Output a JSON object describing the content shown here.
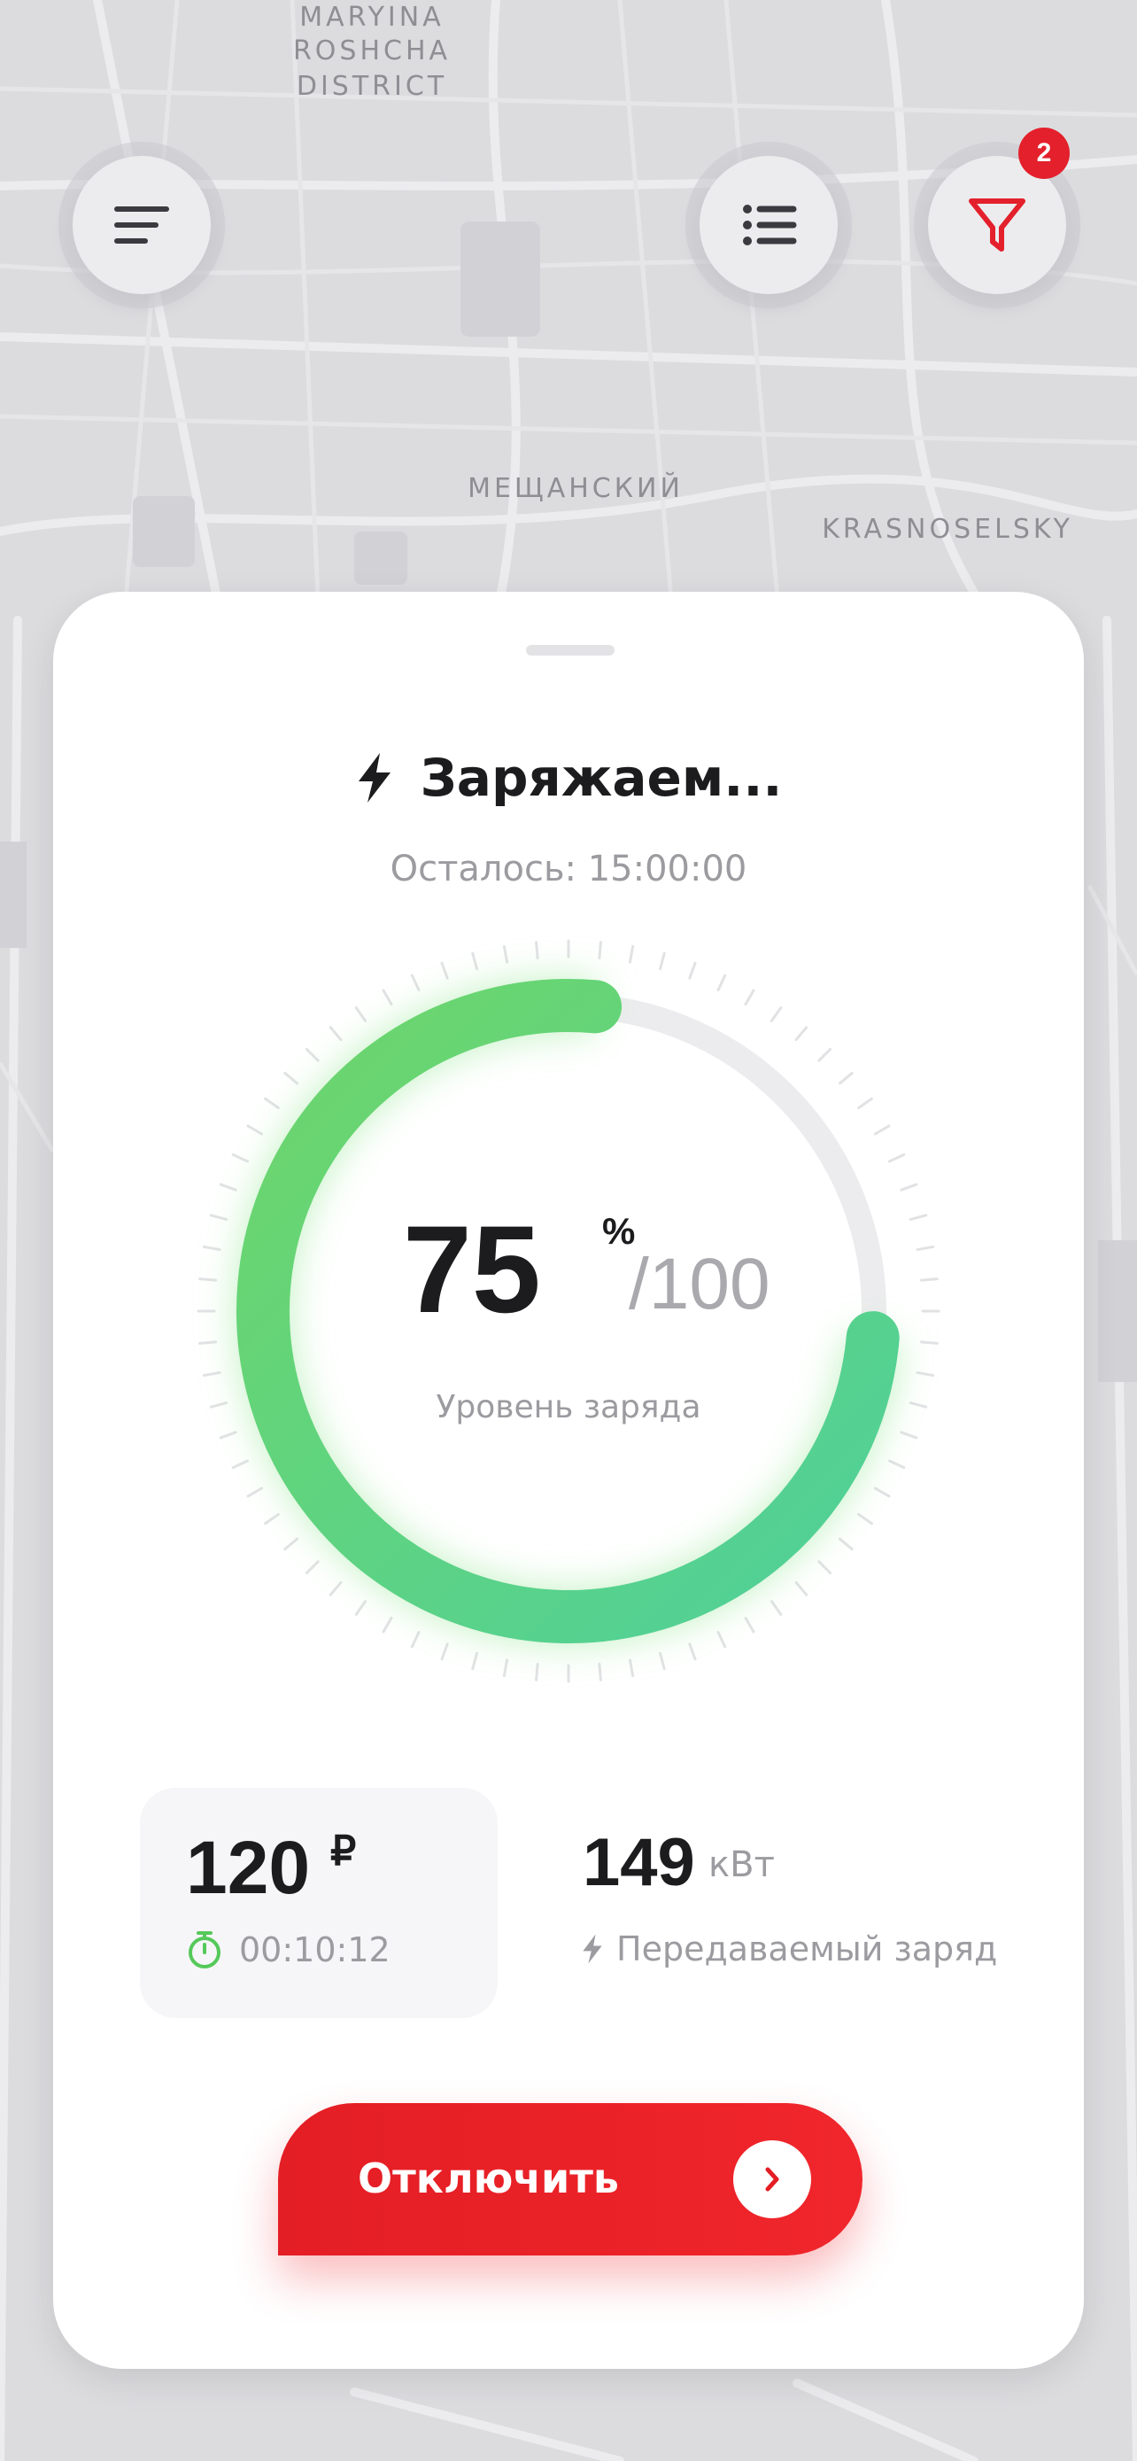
{
  "map": {
    "labels": {
      "maryina": "MARYINA",
      "roshcha": "ROSHCHA",
      "district": "DISTRICT",
      "meshchansky": "МЕЩАНСКИЙ",
      "krasnoselsky": "KRASNOSELSKY"
    }
  },
  "toolbar": {
    "filter_count": "2"
  },
  "status": {
    "title": "Заряжаем...",
    "remaining_label": "Осталось:",
    "remaining_time": "15:00:00"
  },
  "charge": {
    "level": 75,
    "level_text": "75",
    "unit": "%",
    "total_text": "/100",
    "caption": "Уровень заряда"
  },
  "cost": {
    "amount": "120",
    "currency": "₽",
    "elapsed": "00:10:12"
  },
  "energy": {
    "value": "149",
    "unit": "кВт",
    "caption": "Передаваемый заряд"
  },
  "action": {
    "disconnect_label": "Отключить"
  },
  "colors": {
    "accent_red": "#e31e24",
    "gauge_green_start": "#6ed66a",
    "gauge_green_end": "#4fd09a",
    "track_gray": "#ececee"
  }
}
